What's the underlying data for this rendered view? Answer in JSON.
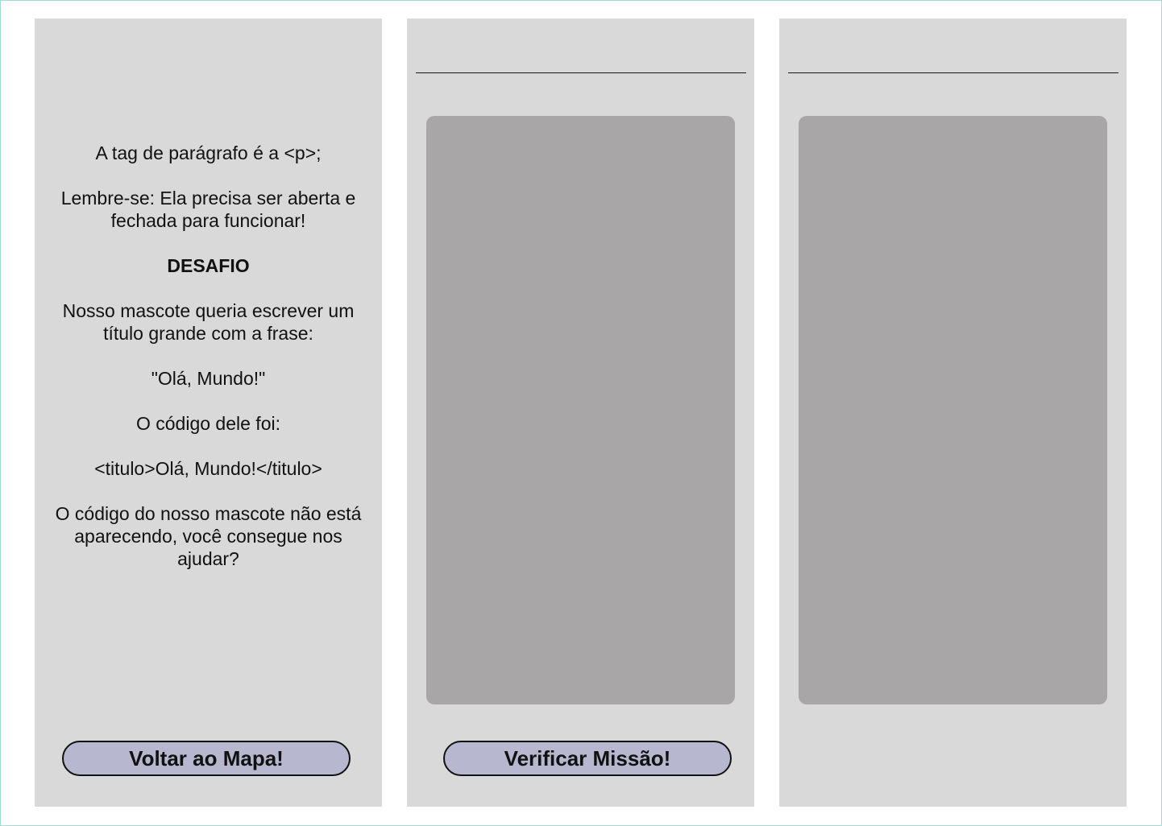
{
  "left_panel": {
    "paragraphs": [
      "A tag de parágrafo é a <p>;",
      "Lembre-se: Ela precisa ser aberta e fechada para funcionar!",
      "DESAFIO",
      "Nosso mascote queria escrever um título grande com a frase:",
      "\"Olá, Mundo!\"",
      "O código dele foi:",
      "<titulo>Olá, Mundo!</titulo>",
      "O código do nosso mascote não está aparecendo, você consegue nos ajudar?"
    ],
    "back_button_label": "Voltar ao Mapa!"
  },
  "middle_panel": {
    "verify_button_label": "Verificar Missão!"
  },
  "colors": {
    "panel_background": "#d9d9d9",
    "editor_background": "#a9a6a7",
    "button_background": "#b7b7cf",
    "text": "#111111"
  }
}
